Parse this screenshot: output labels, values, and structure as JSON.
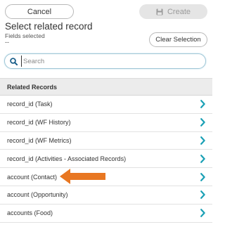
{
  "toolbar": {
    "cancel_label": "Cancel",
    "create_label": "Create",
    "create_icon": "floppy-disk-icon"
  },
  "header": {
    "title": "Select related record",
    "fields_label": "Fields selected",
    "fields_value": "--",
    "clear_label": "Clear Selection"
  },
  "search": {
    "placeholder": "Search",
    "icon": "search-icon"
  },
  "list": {
    "header": "Related Records",
    "rows": [
      {
        "label": "record_id (Task)"
      },
      {
        "label": "record_id (WF History)"
      },
      {
        "label": "record_id (WF Metrics)"
      },
      {
        "label": "record_id (Activities - Associated Records)"
      },
      {
        "label": "account (Contact)"
      },
      {
        "label": "account (Opportunity)"
      },
      {
        "label": "accounts (Food)"
      }
    ]
  },
  "annotation": {
    "target_row": "account (Contact)",
    "color": "#e87722"
  },
  "colors": {
    "chevron": "#1aa0b5",
    "search_icon": "#1a5f8a",
    "disabled_button": "#e5e5e5"
  }
}
